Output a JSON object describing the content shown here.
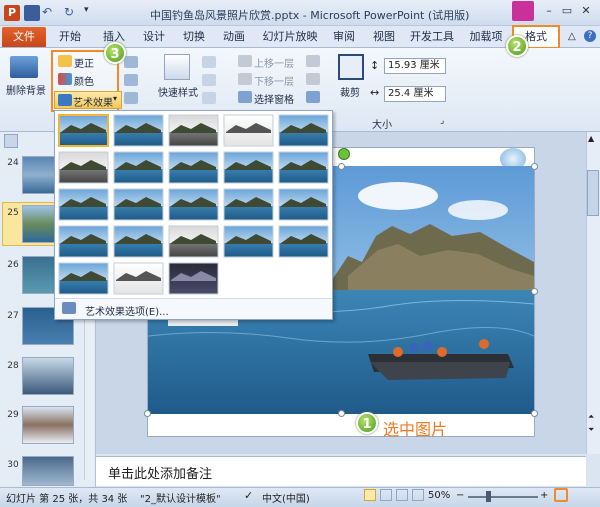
{
  "window": {
    "title": "中国钓鱼岛风景照片欣赏.pptx - Microsoft PowerPoint (试用版)",
    "app_icon": "P"
  },
  "tabs": [
    "开始",
    "插入",
    "设计",
    "切换",
    "动画",
    "幻灯片放映",
    "审阅",
    "视图",
    "开发工具",
    "加载项",
    "格式"
  ],
  "file_tab": "文件",
  "ribbon": {
    "remove_bg": "删除背景",
    "corrections": "更正",
    "color": "颜色",
    "artistic": "艺术效果",
    "quick_styles": "快速样式",
    "bring_forward": "上移一层",
    "send_backward": "下移一层",
    "selection_pane": "选择窗格",
    "crop": "裁剪",
    "height_value": "15.93 厘米",
    "width_value": "25.4 厘米",
    "size_group": "大小"
  },
  "annotations": {
    "one": "1",
    "two": "2",
    "three": "3",
    "caption": "选中图片"
  },
  "dropdown": {
    "footer_label": "艺术效果选项(E)..."
  },
  "slides": [
    {
      "num": "24"
    },
    {
      "num": "25"
    },
    {
      "num": "26"
    },
    {
      "num": "27"
    },
    {
      "num": "28"
    },
    {
      "num": "29"
    },
    {
      "num": "30"
    }
  ],
  "notes_placeholder": "单击此处添加备注",
  "status": {
    "slide_info": "幻灯片 第 25 张，共 34 张",
    "theme": "\"2_默认设计模板\"",
    "language": "中文(中国)",
    "zoom": "50%"
  },
  "colors": {
    "accent": "#f28a2a",
    "file_tab": "#d8531f",
    "badge": "#5aa820"
  }
}
